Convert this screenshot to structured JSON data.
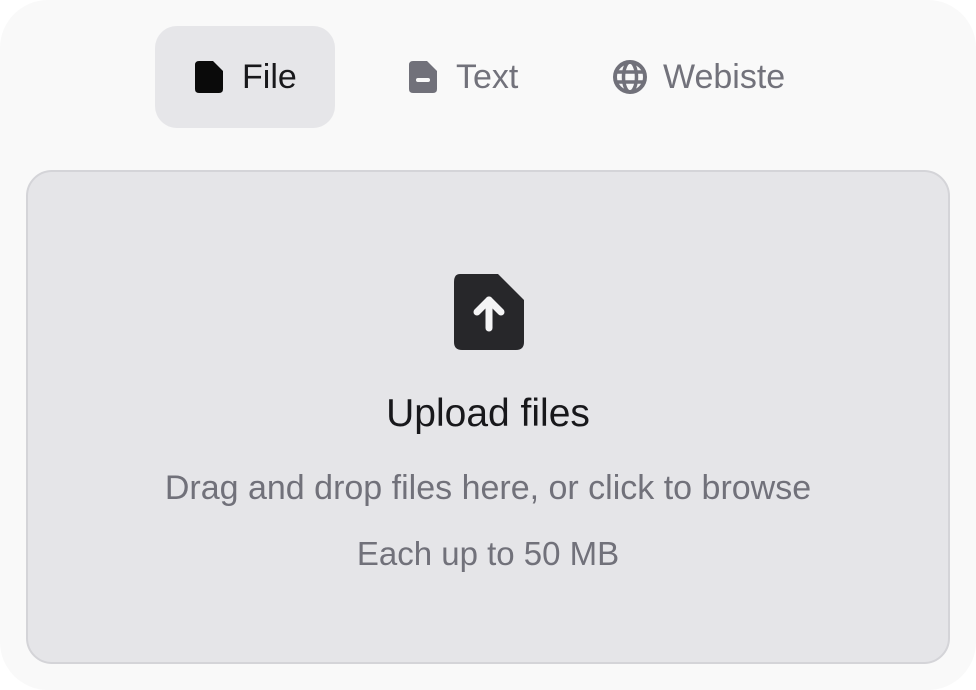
{
  "tabs": [
    {
      "label": "File",
      "icon": "file-icon",
      "active": true
    },
    {
      "label": "Text",
      "icon": "text-file-icon",
      "active": false
    },
    {
      "label": "Webiste",
      "icon": "globe-icon",
      "active": false
    }
  ],
  "dropzone": {
    "icon": "file-upload-icon",
    "title": "Upload files",
    "subtitle": "Drag and drop files here, or click to browse",
    "limit": "Each up to 50 MB"
  },
  "colors": {
    "panel_background": "#f9f9f9",
    "active_tab_background": "#e6e6e9",
    "dropzone_background": "#e5e5e8",
    "dropzone_border": "#d4d4d8",
    "primary_text": "#18181b",
    "muted_text": "#71717a",
    "icon_dark": "#27272a"
  }
}
